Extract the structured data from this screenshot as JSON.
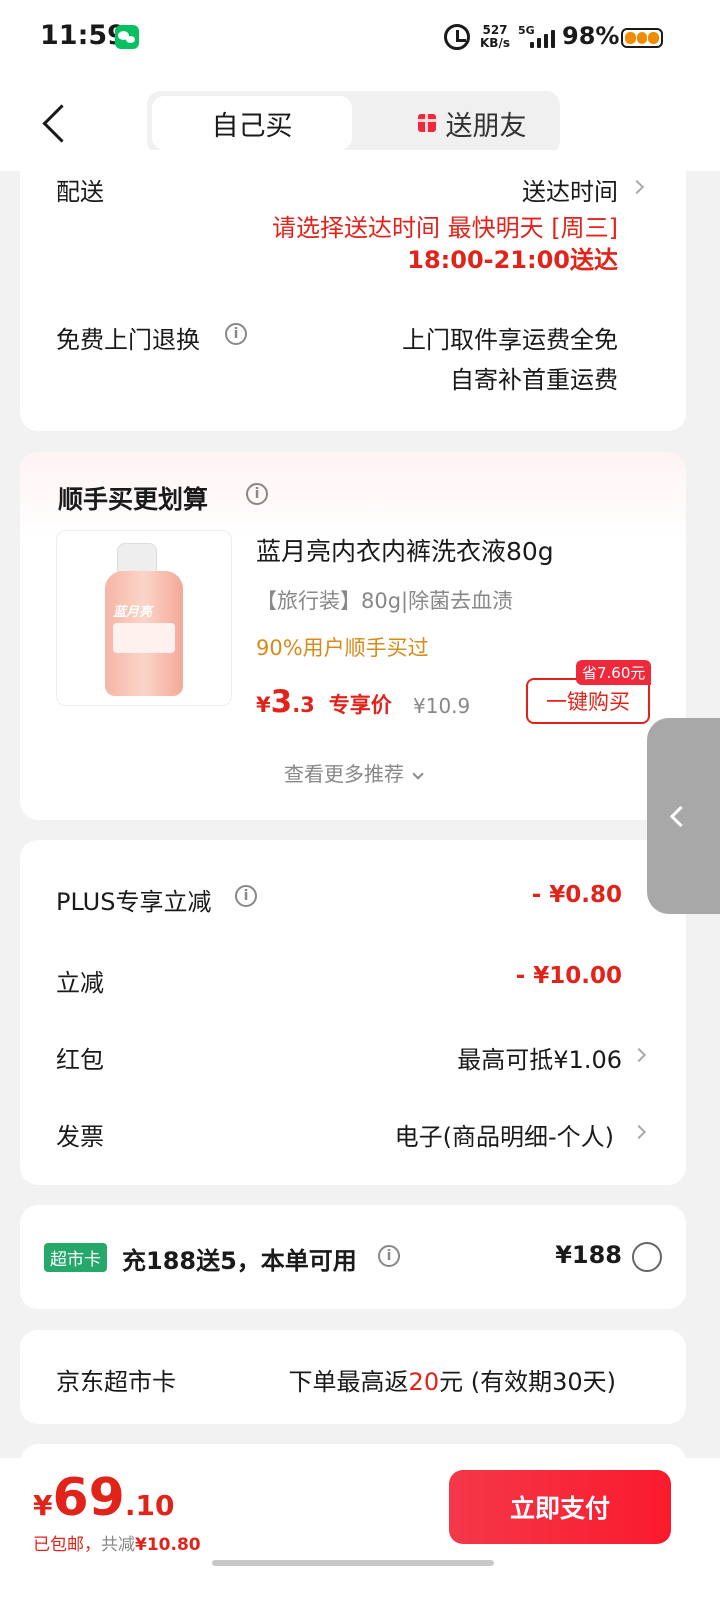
{
  "status_bar": {
    "time": "11:59",
    "speed_value": "527",
    "speed_unit": "KB/s",
    "network": "5G",
    "battery": "98%"
  },
  "header": {
    "tab_self": "自己买",
    "tab_gift": "送朋友"
  },
  "delivery": {
    "label": "配送",
    "time_label": "送达时间",
    "prompt": "请选择送达时间  最快明天 [周三]",
    "time_range": "18:00-21:00送达"
  },
  "returns": {
    "label": "免费上门退换",
    "line1": "上门取件享运费全免",
    "line2": "自寄补首重运费"
  },
  "recommend": {
    "title": "顺手买更划算",
    "product_name": "蓝月亮内衣内裤洗衣液80g",
    "product_spec": "【旅行装】80g|除菌去血渍",
    "bought_pct": "90%用户顺手买过",
    "price_symbol": "¥",
    "price_int": "3",
    "price_dec": ".3",
    "price_tag": "专享价",
    "orig_price": "¥10.9",
    "save_tag": "省7.60元",
    "buy_button": "一键购买",
    "more": "查看更多推荐",
    "bottle_brand": "蓝月亮"
  },
  "discounts": {
    "plus_label": "PLUS专享立减",
    "plus_value": "- ¥0.80",
    "cut_label": "立减",
    "cut_value": "- ¥10.00",
    "redpacket_label": "红包",
    "redpacket_value": "最高可抵¥1.06",
    "invoice_label": "发票",
    "invoice_value": "电子(商品明细-个人)"
  },
  "supermarket_card": {
    "chip": "超市卡",
    "text": "充188送5，本单可用",
    "price": "¥188"
  },
  "jd_card": {
    "label": "京东超市卡",
    "pre": "下单最高返",
    "amount": "20",
    "post": "元 (有效期30天)"
  },
  "footer": {
    "yen": "¥",
    "total_int": "69",
    "total_dec": ".10",
    "shipping": "已包邮，",
    "saved_label": "共减",
    "saved_value": "¥10.80",
    "pay_button": "立即支付"
  },
  "colors": {
    "accent_red": "#e2231a",
    "orange": "#d68b1b",
    "green_chip": "#26a86b"
  }
}
